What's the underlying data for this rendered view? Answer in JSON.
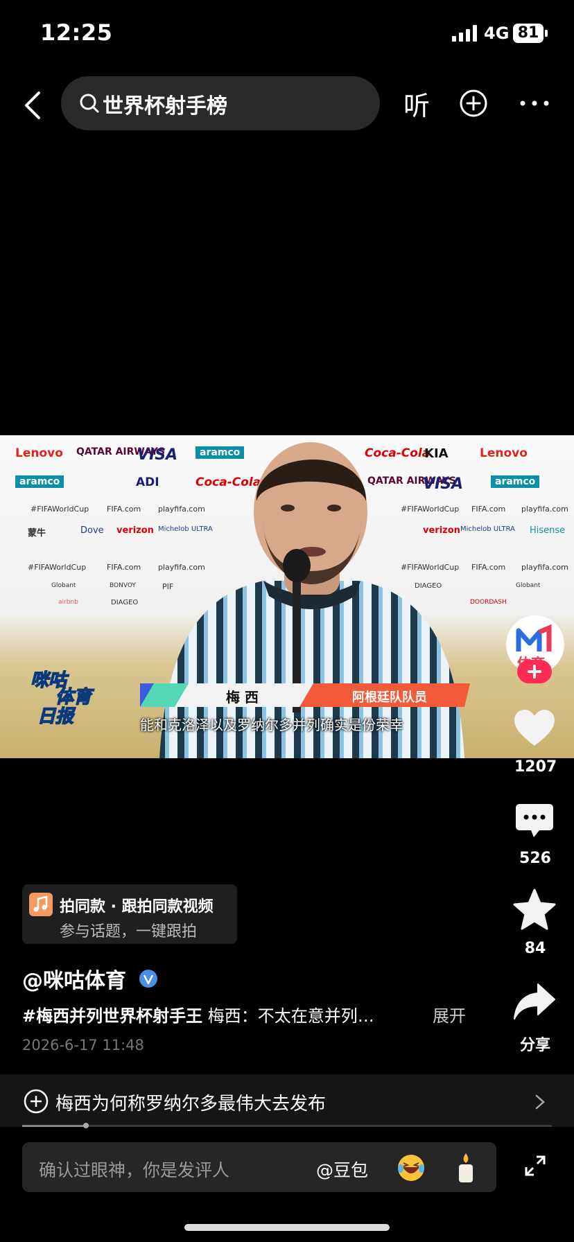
{
  "status_bar": {
    "time": "12:25",
    "network": "4G",
    "battery": "81"
  },
  "nav": {
    "search_text": "世界杯射手榜",
    "listen_label": "听"
  },
  "video": {
    "name_label": "梅 西",
    "team_label": "阿根廷队队员",
    "subtitle": "能和克洛泽以及罗纳尔多并列确实是份荣幸",
    "channel_logo": "咪咕体育日报",
    "sponsors": [
      "Lenovo",
      "QATAR AIRWAYS",
      "VISA",
      "aramco",
      "Coca-Cola",
      "KIA",
      "ADI",
      "Dove",
      "verizon",
      "Hisense",
      "Michelob ULTRA",
      "蒙牛",
      "#FIFAWorldCup",
      "FIFA.com",
      "playfifa.com",
      "PIF",
      "DIAGEO",
      "airbnb",
      "BONVOY",
      "Globant",
      "DOORDASH"
    ]
  },
  "actions": {
    "author_avatar_text": "体育",
    "likes": "1207",
    "comments": "526",
    "favorites": "84",
    "share": "分享"
  },
  "template": {
    "title": "拍同款 · 跟拍同款视频",
    "subtitle": "参与话题，一键跟拍"
  },
  "post": {
    "author": "@咪咕体育",
    "hashtag": "#梅西并列世界杯射手王",
    "caption": " 梅西：不太在意并列…",
    "expand": "展开",
    "date": "2026-6-17 11:48"
  },
  "related": {
    "text": "梅西为何称罗纳尔多最伟大去发布",
    "progress": 0.12
  },
  "comment_bar": {
    "placeholder": "确认过眼神，你是发评人",
    "mention": "@豆包"
  },
  "colors": {
    "background": "#000000",
    "accent": "#fe2c55",
    "verified": "#4a90e2"
  }
}
